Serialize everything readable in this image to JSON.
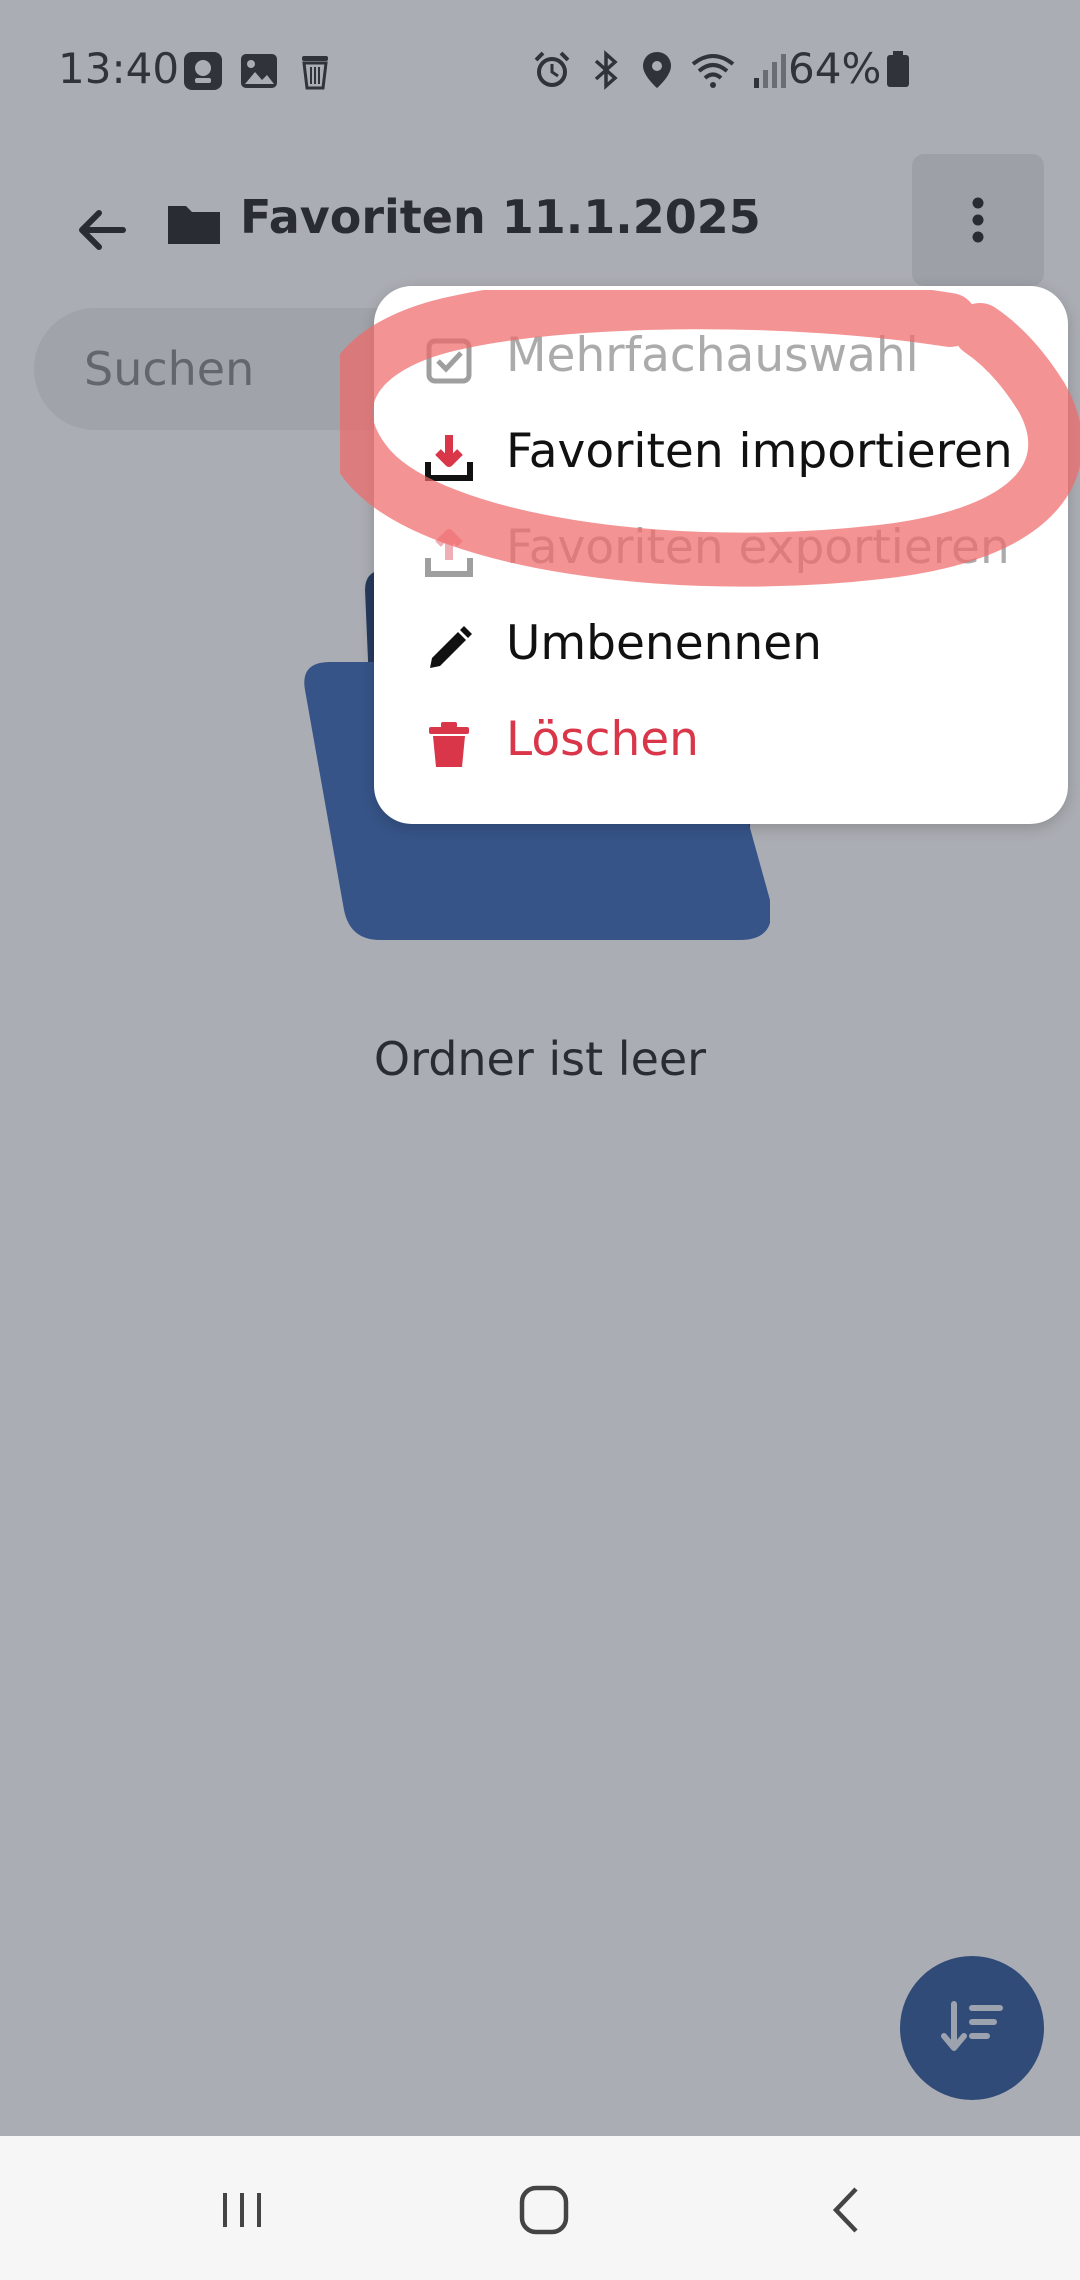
{
  "status_bar": {
    "time": "13:40",
    "battery": "64%"
  },
  "header": {
    "title": "Favoriten 11.1.2025"
  },
  "search": {
    "placeholder": "Suchen"
  },
  "empty_state": {
    "text": "Ordner ist leer"
  },
  "menu": {
    "items": [
      {
        "label": "Mehrfachauswahl",
        "icon": "checkbox-icon",
        "state": "disabled"
      },
      {
        "label": "Favoriten importieren",
        "icon": "download-icon",
        "state": "enabled"
      },
      {
        "label": "Favoriten exportieren",
        "icon": "upload-icon",
        "state": "disabled"
      },
      {
        "label": "Umbenennen",
        "icon": "pencil-icon",
        "state": "enabled"
      },
      {
        "label": "Löschen",
        "icon": "trash-icon",
        "state": "destructive"
      }
    ]
  },
  "colors": {
    "accent": "#1f4a92",
    "destructive": "#d9364a",
    "highlight": "#f06a6a"
  }
}
